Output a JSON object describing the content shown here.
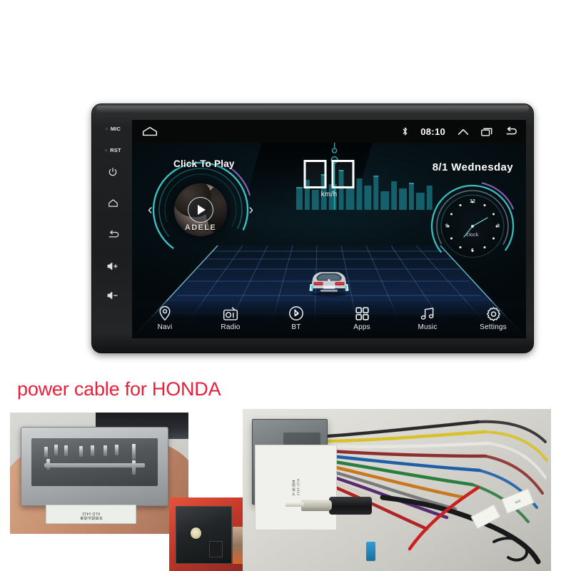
{
  "product": {
    "caption": "power cable for HONDA",
    "caption_color": "#e8203a"
  },
  "head_unit": {
    "side_buttons": [
      {
        "name": "mic",
        "label": "MIC",
        "type": "led-label"
      },
      {
        "name": "reset",
        "label": "RST",
        "type": "led-label"
      },
      {
        "name": "power",
        "label": "power-icon",
        "type": "icon"
      },
      {
        "name": "home",
        "label": "home-icon",
        "type": "icon"
      },
      {
        "name": "back",
        "label": "back-icon",
        "type": "icon"
      },
      {
        "name": "volume-up",
        "label": "volume-up-icon",
        "type": "icon"
      },
      {
        "name": "volume-down",
        "label": "volume-down-icon",
        "type": "icon"
      }
    ]
  },
  "status_bar": {
    "home_icon": "home-icon",
    "bluetooth_icon": "bluetooth-icon",
    "time": "08:10",
    "expand_icon": "chevron-up-icon",
    "recents_icon": "recent-apps-icon",
    "back_icon": "back-arrow-icon"
  },
  "home_screen": {
    "music_widget": {
      "title": "Click To Play",
      "album_artist": "ADELE",
      "play_icon": "play-icon",
      "prev_icon": "chevron-left-icon",
      "next_icon": "chevron-right-icon"
    },
    "speed_widget": {
      "digit_1": "",
      "digit_2": "",
      "unit": "km/h"
    },
    "date_widget": {
      "text": "8/1  Wednesday"
    },
    "clock_widget": {
      "label": "clock",
      "numerals": [
        "12",
        "3",
        "6",
        "9"
      ]
    },
    "accent_colors": {
      "teal": "#3fd0cf",
      "purple": "#9b6fd4",
      "grid_blue": "#2b4f8e",
      "skyline_cyan": "#2fb8c4"
    }
  },
  "nav_bar": {
    "items": [
      {
        "label": "Navi",
        "icon": "location-pin-icon"
      },
      {
        "label": "Radio",
        "icon": "radio-icon"
      },
      {
        "label": "BT",
        "icon": "bluetooth-icon"
      },
      {
        "label": "Apps",
        "icon": "apps-grid-icon"
      },
      {
        "label": "Music",
        "icon": "music-note-icon"
      },
      {
        "label": "Settings",
        "icon": "gear-icon"
      }
    ]
  },
  "photos": {
    "left": {
      "name": "honda-connector-housing-photo",
      "label_line_1": "本田插头线束",
      "label_line_2": "KLD-1412"
    },
    "inset": {
      "name": "antenna-adapter-closeup-photo"
    },
    "right": {
      "name": "wiring-harness-photo",
      "label_line_1": "本田 插 头",
      "label_line_2": "KLD-1412"
    }
  }
}
